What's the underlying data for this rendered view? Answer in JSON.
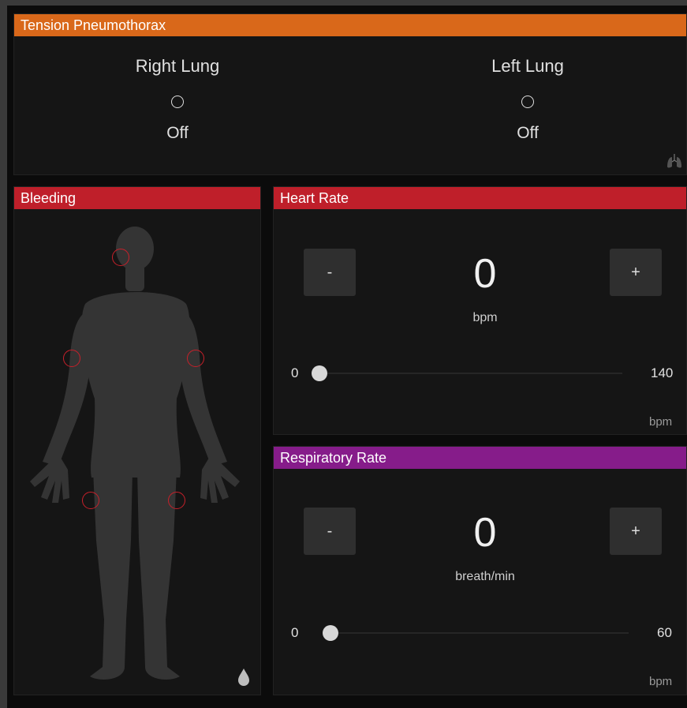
{
  "colors": {
    "tension_header": "#d9681a",
    "bleeding_header": "#bf1f2a",
    "heart_header": "#bf1f2a",
    "resp_header": "#861c8a",
    "body_silhouette": "#343434",
    "bleed_marker": "#c8202a"
  },
  "tension": {
    "title": "Tension Pneumothorax",
    "right_lung": {
      "label": "Right Lung",
      "state": "Off"
    },
    "left_lung": {
      "label": "Left Lung",
      "state": "Off"
    },
    "icon": "lungs-icon"
  },
  "bleeding": {
    "title": "Bleeding",
    "icon": "blood-drop-icon",
    "points": [
      "head",
      "right-arm",
      "left-arm",
      "right-leg",
      "left-leg"
    ]
  },
  "heart_rate": {
    "title": "Heart Rate",
    "minus_label": "-",
    "plus_label": "+",
    "value": "0",
    "unit": "bpm",
    "min_label": "0",
    "max_label": "140",
    "corner_unit": "bpm",
    "slider_fraction": 0
  },
  "resp_rate": {
    "title": "Respiratory Rate",
    "minus_label": "-",
    "plus_label": "+",
    "value": "0",
    "unit": "breath/min",
    "min_label": "0",
    "max_label": "60",
    "corner_unit": "bpm",
    "slider_fraction": 0
  }
}
